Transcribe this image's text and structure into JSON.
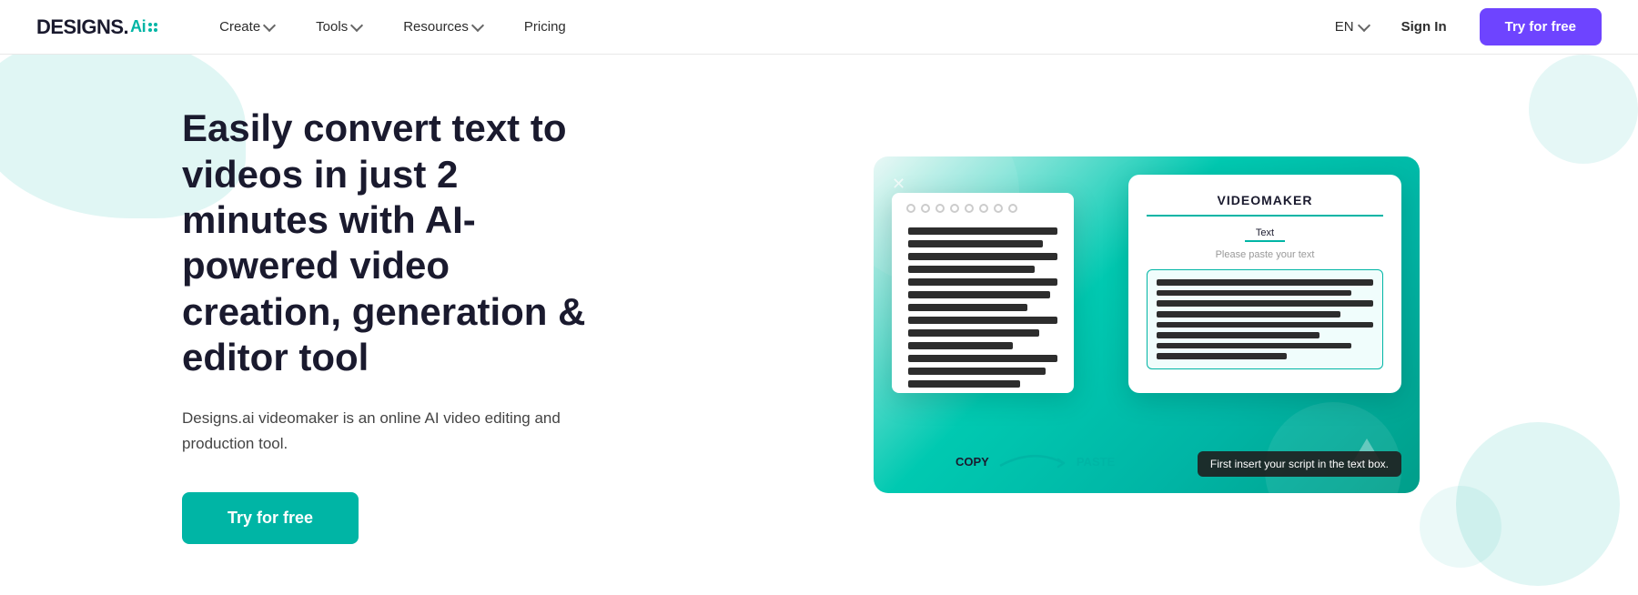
{
  "logo": {
    "text": "DESIGNS.",
    "ai_suffix": "Ai"
  },
  "nav": {
    "create_label": "Create",
    "tools_label": "Tools",
    "resources_label": "Resources",
    "pricing_label": "Pricing",
    "lang_label": "EN",
    "sign_in_label": "Sign In",
    "try_free_label": "Try for free"
  },
  "hero": {
    "title": "Easily convert text to videos in just 2 minutes with AI-powered video creation, generation & editor tool",
    "description": "Designs.ai videomaker is an online AI video editing and production tool.",
    "cta_label": "Try for free"
  },
  "videomaker_card": {
    "title": "VIDEOMAKER",
    "tab_text": "Text",
    "placeholder": "Please paste your text",
    "copy_label": "COPY",
    "paste_label": "PASTE",
    "tooltip": "First insert your script in the text box."
  }
}
